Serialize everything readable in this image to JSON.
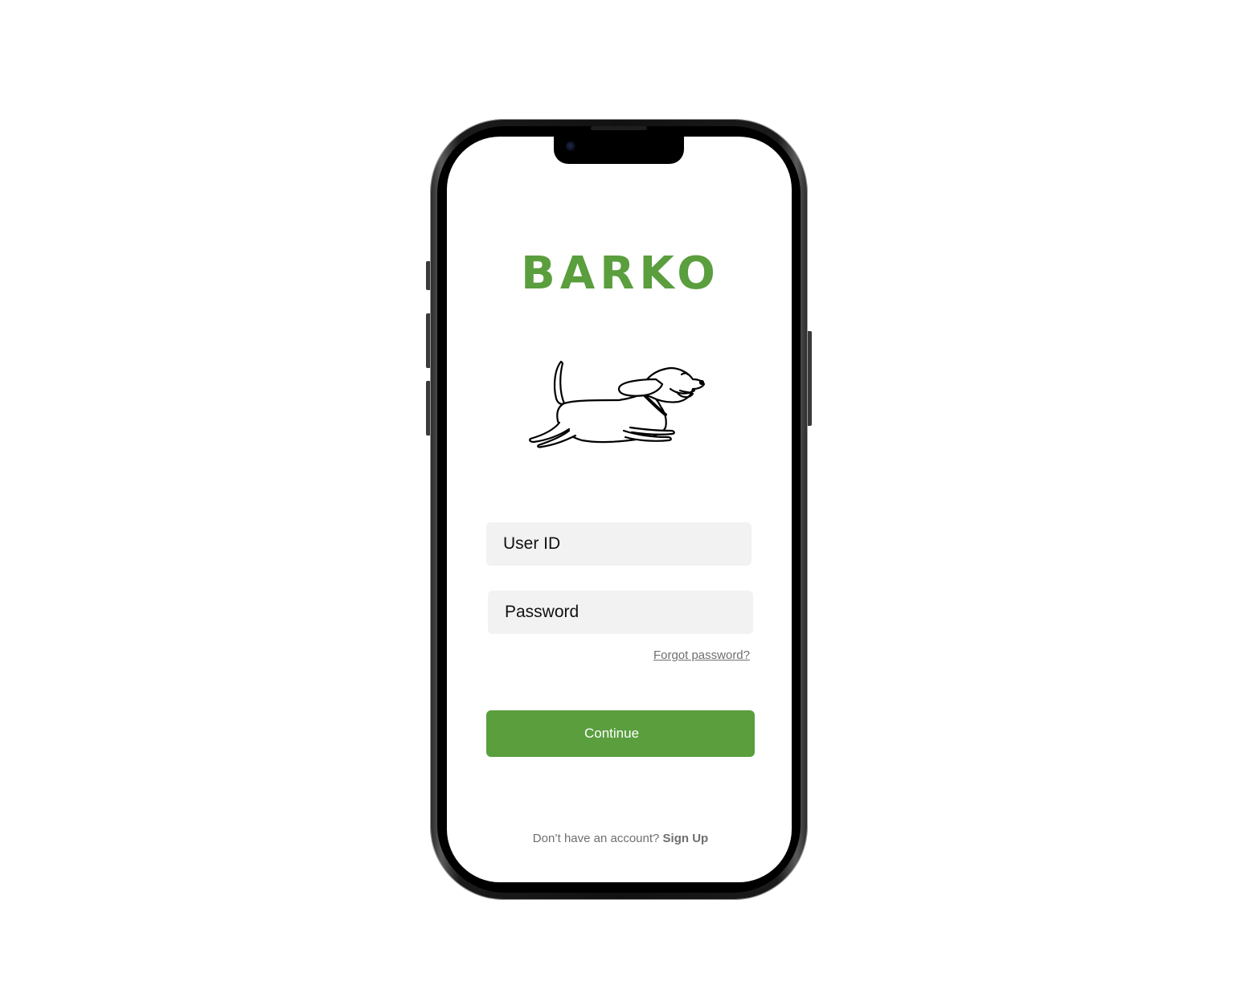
{
  "app": {
    "brand_title": "BARKO"
  },
  "login_form": {
    "user_id_placeholder": "User ID",
    "password_placeholder": "Password",
    "forgot_password_label": "Forgot password?",
    "continue_label": "Continue"
  },
  "footer": {
    "no_account_text": "Don’t have an account? ",
    "sign_up_label": "Sign Up"
  },
  "icons": {
    "illustration": "running-dachshund-illustration"
  },
  "colors": {
    "brand_green": "#5a9e3e",
    "input_background": "#f2f2f2",
    "muted_text": "#6f6f6f"
  }
}
